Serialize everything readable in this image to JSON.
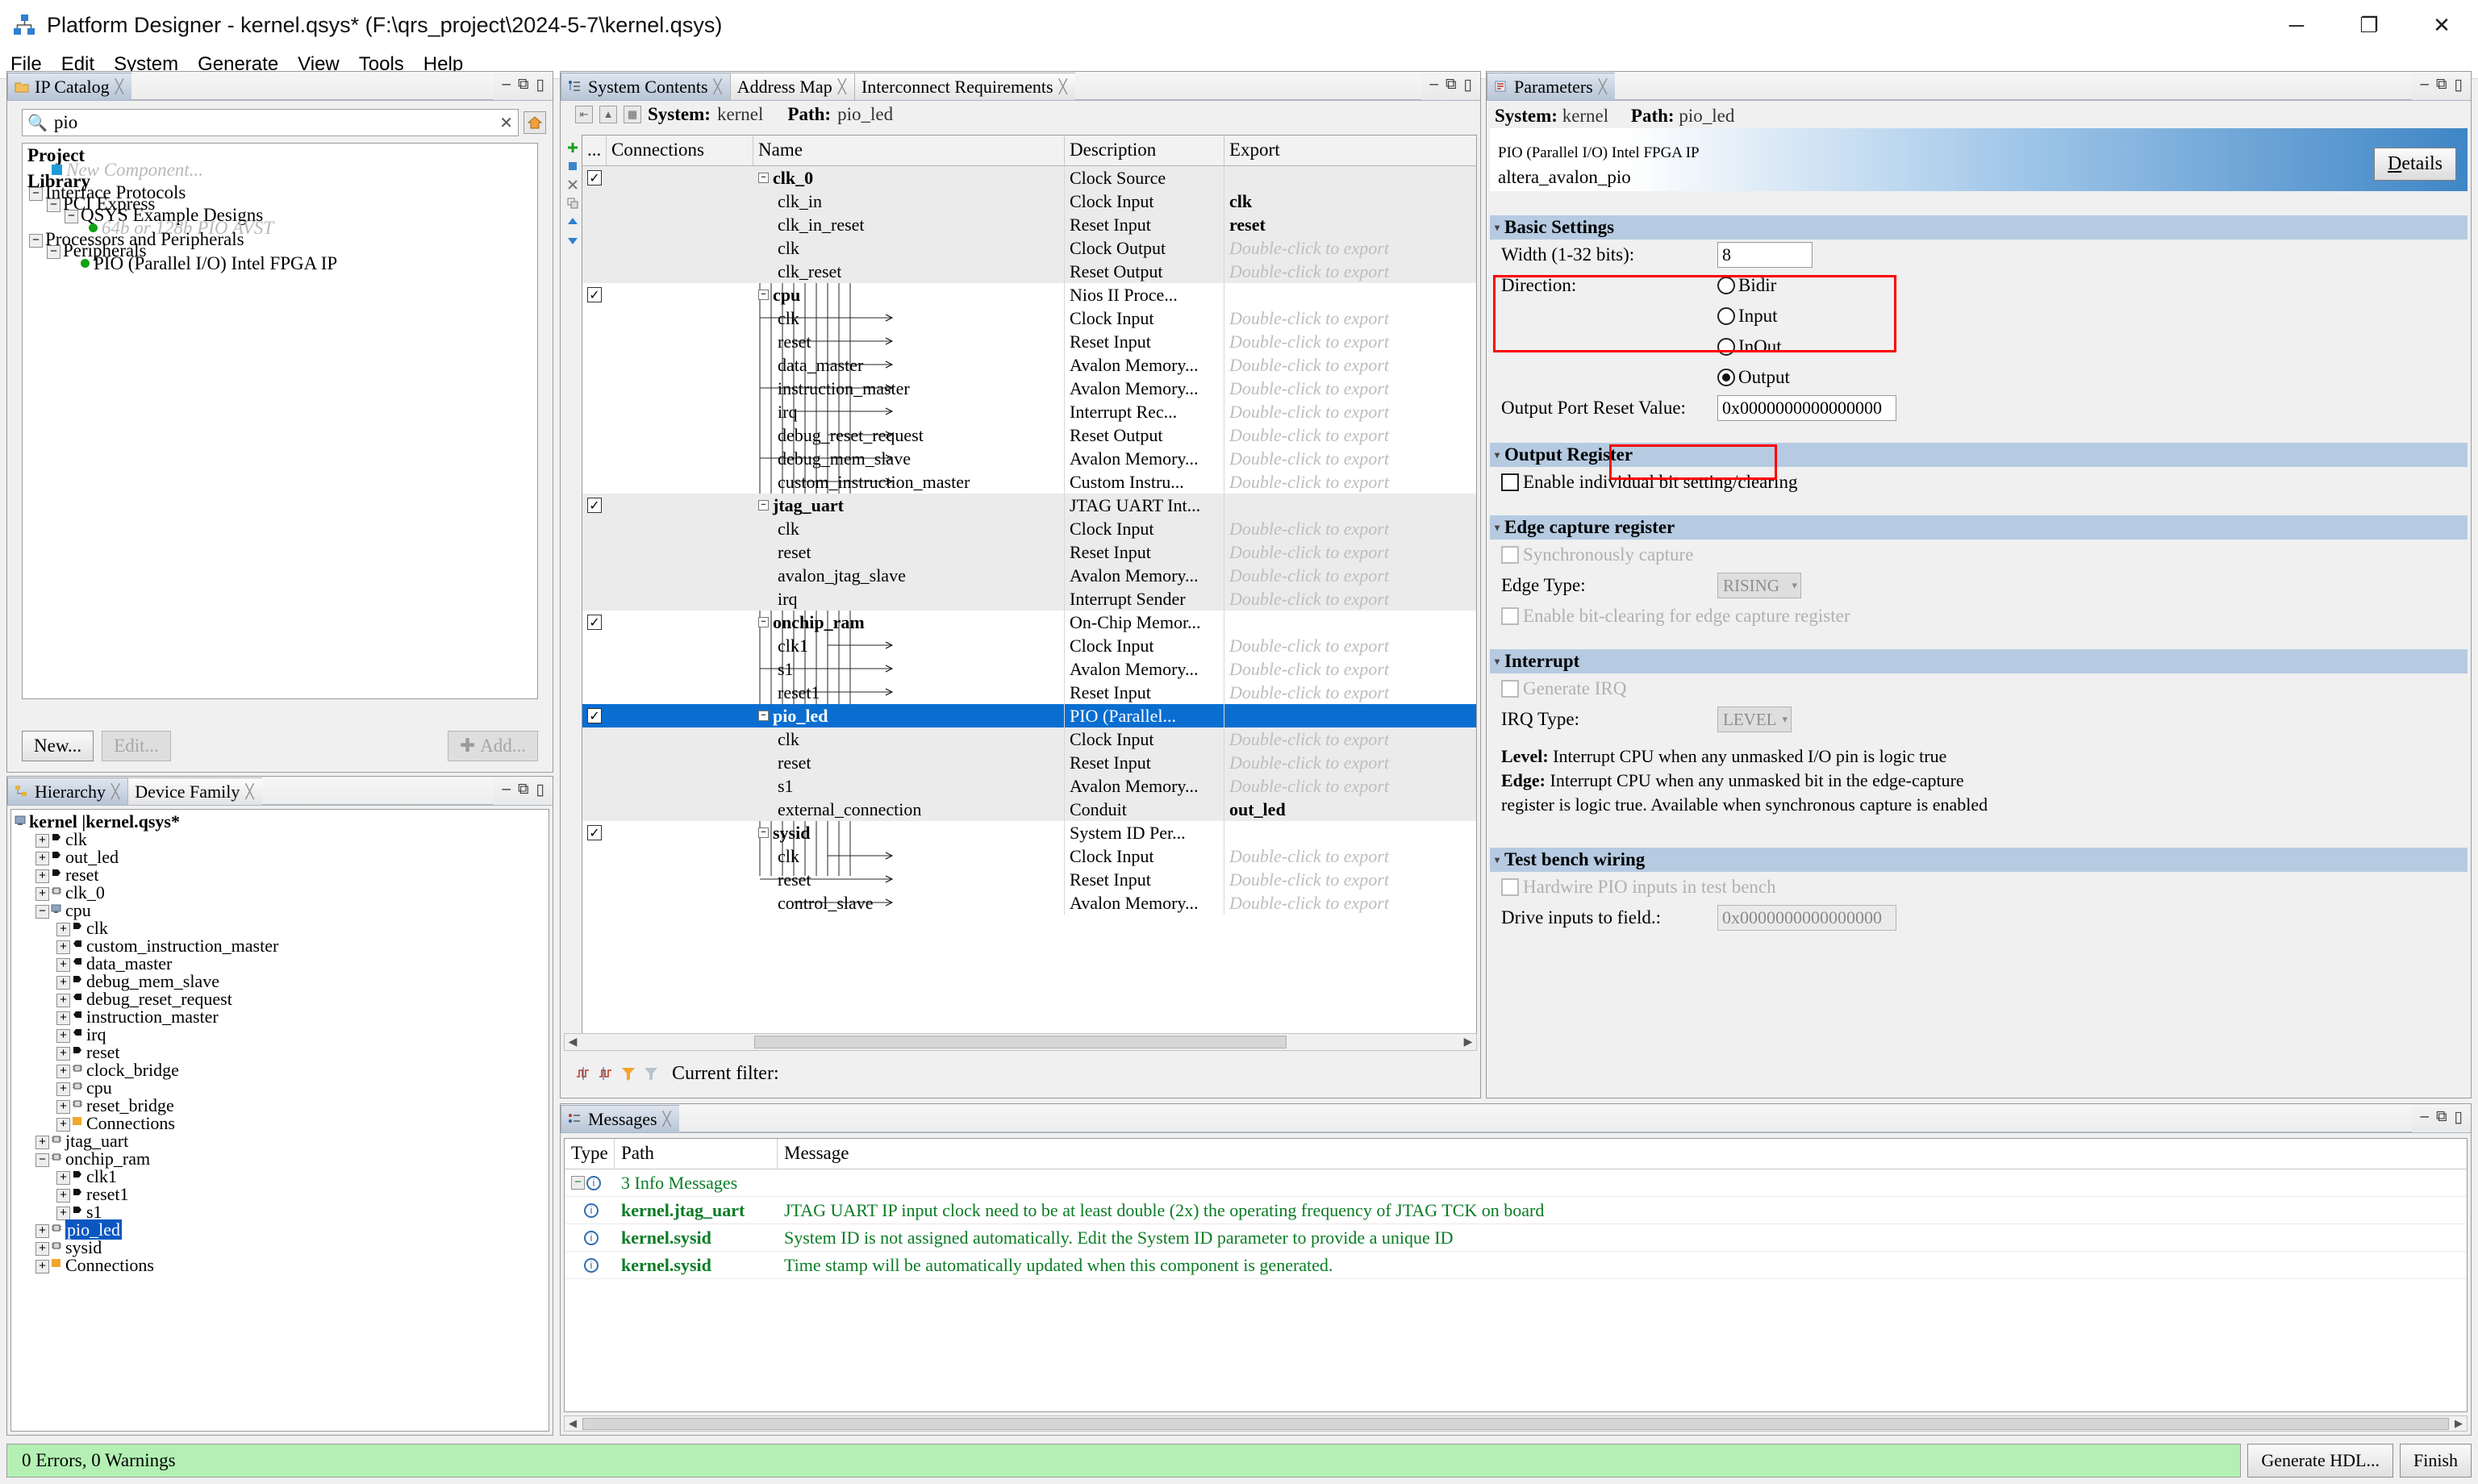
{
  "window": {
    "title": "Platform Designer - kernel.qsys* (F:\\qrs_project\\2024-5-7\\kernel.qsys)",
    "minimize": "─",
    "maximize": "❐",
    "close": "✕"
  },
  "menu": [
    "File",
    "Edit",
    "System",
    "Generate",
    "View",
    "Tools",
    "Help"
  ],
  "ip_catalog": {
    "tab_label": "IP Catalog",
    "search_value": "pio",
    "search_placeholder": "",
    "clear_label": "✕",
    "tree": [
      {
        "text": "Project",
        "indent": 0,
        "style": "bold"
      },
      {
        "text": "New Component...",
        "indent": 1,
        "style": "grayed"
      },
      {
        "text": "Library",
        "indent": 0,
        "style": "bold"
      },
      {
        "text": "Interface Protocols",
        "indent": 0,
        "style": "normal",
        "expander": "−"
      },
      {
        "text": "PCI Express",
        "indent": 1,
        "style": "normal",
        "expander": "−"
      },
      {
        "text": "QSYS Example Designs",
        "indent": 2,
        "style": "normal",
        "expander": "−"
      },
      {
        "text": "64b or 128b PIO AVST",
        "indent": 3,
        "style": "grayed",
        "dot": true
      },
      {
        "text": "Processors and Peripherals",
        "indent": 0,
        "style": "normal",
        "expander": "−"
      },
      {
        "text": "Peripherals",
        "indent": 1,
        "style": "normal",
        "expander": "−"
      },
      {
        "text": "PIO (Parallel I/O) Intel FPGA IP",
        "indent": 2,
        "style": "normal",
        "dot": true
      }
    ],
    "buttons": {
      "new": "New...",
      "edit": "Edit...",
      "add": "Add..."
    }
  },
  "hierarchy": {
    "tabs": [
      {
        "label": "Hierarchy",
        "active": true
      },
      {
        "label": "Device Family",
        "active": false
      }
    ],
    "root": "kernel  |kernel.qsys*",
    "items": [
      {
        "text": "clk",
        "indent": 1,
        "pm": "+",
        "icon": "port"
      },
      {
        "text": "out_led",
        "indent": 1,
        "pm": "+",
        "icon": "port"
      },
      {
        "text": "reset",
        "indent": 1,
        "pm": "+",
        "icon": "port"
      },
      {
        "text": "clk_0",
        "indent": 1,
        "pm": "+",
        "icon": "module"
      },
      {
        "text": "cpu",
        "indent": 1,
        "pm": "−",
        "icon": "cpu"
      },
      {
        "text": "clk",
        "indent": 2,
        "pm": "+",
        "icon": "port"
      },
      {
        "text": "custom_instruction_master",
        "indent": 2,
        "pm": "+",
        "icon": "master"
      },
      {
        "text": "data_master",
        "indent": 2,
        "pm": "+",
        "icon": "master"
      },
      {
        "text": "debug_mem_slave",
        "indent": 2,
        "pm": "+",
        "icon": "port"
      },
      {
        "text": "debug_reset_request",
        "indent": 2,
        "pm": "+",
        "icon": "master"
      },
      {
        "text": "instruction_master",
        "indent": 2,
        "pm": "+",
        "icon": "master"
      },
      {
        "text": "irq",
        "indent": 2,
        "pm": "+",
        "icon": "master"
      },
      {
        "text": "reset",
        "indent": 2,
        "pm": "+",
        "icon": "port"
      },
      {
        "text": "clock_bridge",
        "indent": 2,
        "pm": "+",
        "icon": "module"
      },
      {
        "text": "cpu",
        "indent": 2,
        "pm": "+",
        "icon": "module"
      },
      {
        "text": "reset_bridge",
        "indent": 2,
        "pm": "+",
        "icon": "module"
      },
      {
        "text": "Connections",
        "indent": 2,
        "pm": "+",
        "icon": "folder"
      },
      {
        "text": "jtag_uart",
        "indent": 1,
        "pm": "+",
        "icon": "module"
      },
      {
        "text": "onchip_ram",
        "indent": 1,
        "pm": "−",
        "icon": "module"
      },
      {
        "text": "clk1",
        "indent": 2,
        "pm": "+",
        "icon": "port"
      },
      {
        "text": "reset1",
        "indent": 2,
        "pm": "+",
        "icon": "port"
      },
      {
        "text": "s1",
        "indent": 2,
        "pm": "+",
        "icon": "port"
      },
      {
        "text": "pio_led",
        "indent": 1,
        "pm": "+",
        "icon": "module",
        "selected": true
      },
      {
        "text": "sysid",
        "indent": 1,
        "pm": "+",
        "icon": "module"
      },
      {
        "text": "Connections",
        "indent": 1,
        "pm": "+",
        "icon": "folder"
      }
    ]
  },
  "system_contents": {
    "tabs": [
      {
        "label": "System Contents",
        "active": true
      },
      {
        "label": "Address Map",
        "active": false
      },
      {
        "label": "Interconnect Requirements",
        "active": false
      }
    ],
    "system_label": "System:",
    "system_value": "kernel",
    "path_label": "Path:",
    "path_value": "pio_led",
    "columns": [
      "...",
      "Connections",
      "Name",
      "Description",
      "Export"
    ],
    "filter_label": "Current filter:",
    "filter_value": "",
    "rows": [
      {
        "use": true,
        "name": "clk_0",
        "desc": "Clock Source",
        "export": "",
        "group": true,
        "alt": true
      },
      {
        "use": null,
        "name": "clk_in",
        "desc": "Clock Input",
        "export": "clk",
        "group": false,
        "alt": true
      },
      {
        "use": null,
        "name": "clk_in_reset",
        "desc": "Reset Input",
        "export": "reset",
        "group": false,
        "alt": true
      },
      {
        "use": null,
        "name": "clk",
        "desc": "Clock Output",
        "export": "Double-click to export",
        "group": false,
        "alt": true,
        "dim": true
      },
      {
        "use": null,
        "name": "clk_reset",
        "desc": "Reset Output",
        "export": "Double-click to export",
        "group": false,
        "alt": true,
        "dim": true
      },
      {
        "use": true,
        "name": "cpu",
        "desc": "Nios II Proce...",
        "export": "",
        "group": true,
        "alt": false
      },
      {
        "use": null,
        "name": "clk",
        "desc": "Clock Input",
        "export": "Double-click to export",
        "group": false,
        "alt": false,
        "dim": true
      },
      {
        "use": null,
        "name": "reset",
        "desc": "Reset Input",
        "export": "Double-click to export",
        "group": false,
        "alt": false,
        "dim": true
      },
      {
        "use": null,
        "name": "data_master",
        "desc": "Avalon Memory...",
        "export": "Double-click to export",
        "group": false,
        "alt": false,
        "dim": true
      },
      {
        "use": null,
        "name": "instruction_master",
        "desc": "Avalon Memory...",
        "export": "Double-click to export",
        "group": false,
        "alt": false,
        "dim": true
      },
      {
        "use": null,
        "name": "irq",
        "desc": "Interrupt Rec...",
        "export": "Double-click to export",
        "group": false,
        "alt": false,
        "dim": true
      },
      {
        "use": null,
        "name": "debug_reset_request",
        "desc": "Reset Output",
        "export": "Double-click to export",
        "group": false,
        "alt": false,
        "dim": true
      },
      {
        "use": null,
        "name": "debug_mem_slave",
        "desc": "Avalon Memory...",
        "export": "Double-click to export",
        "group": false,
        "alt": false,
        "dim": true
      },
      {
        "use": null,
        "name": "custom_instruction_master",
        "desc": "Custom Instru...",
        "export": "Double-click to export",
        "group": false,
        "alt": false,
        "dim": true
      },
      {
        "use": true,
        "name": "jtag_uart",
        "desc": "JTAG UART Int...",
        "export": "",
        "group": true,
        "alt": true
      },
      {
        "use": null,
        "name": "clk",
        "desc": "Clock Input",
        "export": "Double-click to export",
        "group": false,
        "alt": true,
        "dim": true
      },
      {
        "use": null,
        "name": "reset",
        "desc": "Reset Input",
        "export": "Double-click to export",
        "group": false,
        "alt": true,
        "dim": true
      },
      {
        "use": null,
        "name": "avalon_jtag_slave",
        "desc": "Avalon Memory...",
        "export": "Double-click to export",
        "group": false,
        "alt": true,
        "dim": true
      },
      {
        "use": null,
        "name": "irq",
        "desc": "Interrupt Sender",
        "export": "Double-click to export",
        "group": false,
        "alt": true,
        "dim": true
      },
      {
        "use": true,
        "name": "onchip_ram",
        "desc": "On-Chip Memor...",
        "export": "",
        "group": true,
        "alt": false
      },
      {
        "use": null,
        "name": "clk1",
        "desc": "Clock Input",
        "export": "Double-click to export",
        "group": false,
        "alt": false,
        "dim": true
      },
      {
        "use": null,
        "name": "s1",
        "desc": "Avalon Memory...",
        "export": "Double-click to export",
        "group": false,
        "alt": false,
        "dim": true
      },
      {
        "use": null,
        "name": "reset1",
        "desc": "Reset Input",
        "export": "Double-click to export",
        "group": false,
        "alt": false,
        "dim": true
      },
      {
        "use": true,
        "name": "pio_led",
        "desc": "PIO (Parallel...",
        "export": "",
        "group": true,
        "alt": false,
        "selected": true
      },
      {
        "use": null,
        "name": "clk",
        "desc": "Clock Input",
        "export": "Double-click to export",
        "group": false,
        "alt": true,
        "dim": true
      },
      {
        "use": null,
        "name": "reset",
        "desc": "Reset Input",
        "export": "Double-click to export",
        "group": false,
        "alt": true,
        "dim": true
      },
      {
        "use": null,
        "name": "s1",
        "desc": "Avalon Memory...",
        "export": "Double-click to export",
        "group": false,
        "alt": true,
        "dim": true
      },
      {
        "use": null,
        "name": "external_connection",
        "desc": "Conduit",
        "export": "out_led",
        "group": false,
        "alt": true
      },
      {
        "use": true,
        "name": "sysid",
        "desc": "System ID Per...",
        "export": "",
        "group": true,
        "alt": false
      },
      {
        "use": null,
        "name": "clk",
        "desc": "Clock Input",
        "export": "Double-click to export",
        "group": false,
        "alt": false,
        "dim": true
      },
      {
        "use": null,
        "name": "reset",
        "desc": "Reset Input",
        "export": "Double-click to export",
        "group": false,
        "alt": false,
        "dim": true
      },
      {
        "use": null,
        "name": "control_slave",
        "desc": "Avalon Memory...",
        "export": "Double-click to export",
        "group": false,
        "alt": false,
        "dim": true
      }
    ]
  },
  "parameters": {
    "tab_label": "Parameters",
    "system_label": "System:",
    "system_value": "kernel",
    "path_label": "Path:",
    "path_value": "pio_led",
    "ip_title": "PIO (Parallel I/O) Intel FPGA IP",
    "ip_subtitle": "altera_avalon_pio",
    "details_button": "Details",
    "basic_settings": {
      "header": "Basic Settings",
      "width_label": "Width (1-32 bits):",
      "width_value": "8",
      "direction_label": "Direction:",
      "options": [
        "Bidir",
        "Input",
        "InOut",
        "Output"
      ],
      "selected": "Output",
      "reset_value_label": "Output Port Reset Value:",
      "reset_value": "0x0000000000000000"
    },
    "output_register": {
      "header": "Output Register",
      "checkbox_label": "Enable individual bit setting/clearing",
      "checked": false
    },
    "edge_capture": {
      "header": "Edge capture register",
      "sync_label": "Synchronously capture",
      "sync_checked": false,
      "edge_type_label": "Edge Type:",
      "edge_type_value": "RISING",
      "bitclear_label": "Enable bit-clearing for edge capture register",
      "bitclear_checked": false
    },
    "interrupt": {
      "header": "Interrupt",
      "gen_irq_label": "Generate IRQ",
      "gen_irq_checked": false,
      "irq_type_label": "IRQ Type:",
      "irq_type_value": "LEVEL",
      "help_line1_bold": "Level:",
      "help_line1": " Interrupt CPU when any unmasked I/O pin is logic true",
      "help_line2_bold": "Edge:",
      "help_line2": " Interrupt CPU when any unmasked bit in the edge-capture",
      "help_line3": "register is logic true. Available when synchronous capture is enabled"
    },
    "test_bench": {
      "header": "Test bench wiring",
      "hardwire_label": "Hardwire PIO inputs in test bench",
      "hardwire_checked": false,
      "drive_label": "Drive inputs to field.:",
      "drive_value": "0x0000000000000000"
    }
  },
  "messages": {
    "tab_label": "Messages",
    "columns": [
      "Type",
      "Path",
      "Message"
    ],
    "summary": "3 Info Messages",
    "rows": [
      {
        "path": "kernel.jtag_uart",
        "message": "JTAG UART IP input clock need to be at least double (2x) the operating frequency of JTAG TCK on board"
      },
      {
        "path": "kernel.sysid",
        "message": "System ID is not assigned automatically. Edit the System ID parameter to provide a unique ID"
      },
      {
        "path": "kernel.sysid",
        "message": "Time stamp will be automatically updated when this component is generated."
      }
    ]
  },
  "statusbar": {
    "status": "0 Errors, 0 Warnings",
    "generate_hdl": "Generate HDL...",
    "finish": "Finish"
  }
}
